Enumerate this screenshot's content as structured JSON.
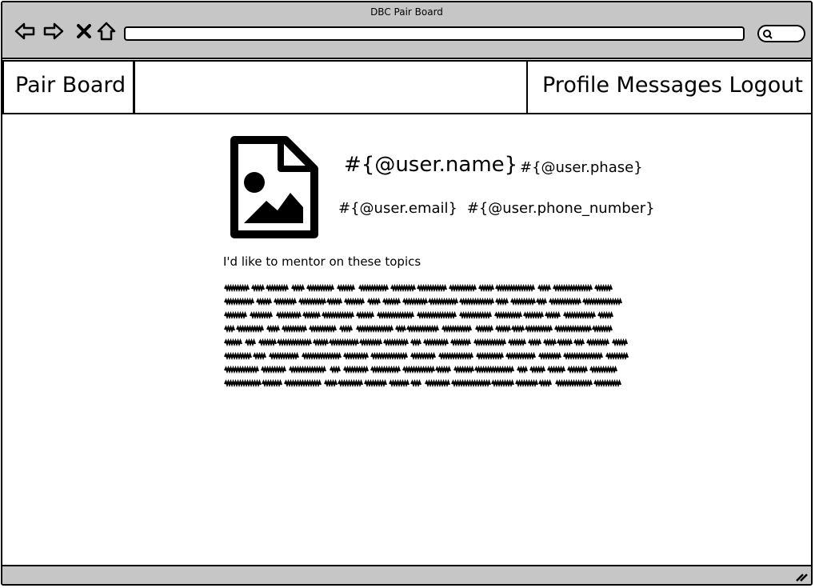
{
  "window": {
    "title": "DBC Pair Board"
  },
  "toolbar": {
    "back_icon": "arrow-left-icon",
    "forward_icon": "arrow-right-icon",
    "close_icon": "x-icon",
    "home_icon": "home-icon",
    "address_value": "",
    "search_icon": "search-icon"
  },
  "header": {
    "brand": "Pair Board",
    "nav": {
      "profile": "Profile",
      "messages": "Messages",
      "logout": "Logout"
    }
  },
  "profile": {
    "avatar_icon": "image-placeholder-icon",
    "name": "#{@user.name}",
    "phase": "#{@user.phase}",
    "email": "#{@user.email}",
    "phone": "#{@user.phone_number}",
    "topics_label": "I'd like to mentor on these topics",
    "topics_text_lines": 8
  }
}
